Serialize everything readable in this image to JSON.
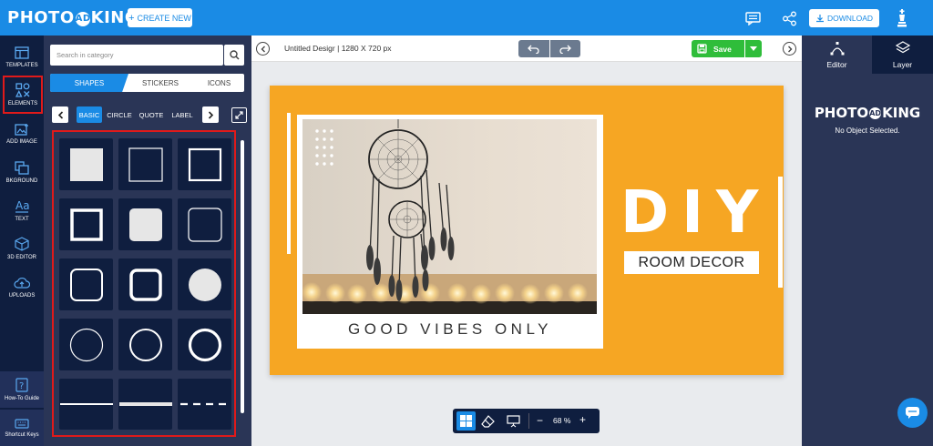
{
  "app": {
    "logo_left": "PHOTO",
    "logo_badge": "AD",
    "logo_right": "KING",
    "create_label": "CREATE NEW",
    "download_label": "DOWNLOAD"
  },
  "nav": {
    "items": [
      {
        "label": "TEMPLATES",
        "icon": "templates-icon"
      },
      {
        "label": "ELEMENTS",
        "icon": "elements-icon"
      },
      {
        "label": "ADD IMAGE",
        "icon": "add-image-icon"
      },
      {
        "label": "BKGROUND",
        "icon": "background-icon"
      },
      {
        "label": "TEXT",
        "icon": "text-icon"
      },
      {
        "label": "3D EDITOR",
        "icon": "3d-editor-icon"
      },
      {
        "label": "UPLOADS",
        "icon": "upload-icon"
      }
    ],
    "howto_label": "How-To Guide",
    "shortcut_label": "Shortcut Keys"
  },
  "panel": {
    "search_placeholder": "Search in category",
    "tabs": [
      "SHAPES",
      "STICKERS",
      "ICONS"
    ],
    "subtabs": [
      "BASIC",
      "CIRCLE",
      "QUOTE",
      "LABEL"
    ]
  },
  "editor": {
    "doc_name": "Untitled Desigr",
    "doc_size": "1280 X 720 px",
    "save_label": "Save",
    "zoom": "68 %"
  },
  "design": {
    "tagline": "GOOD VIBES ONLY",
    "headline": "DIY",
    "subhead": "ROOM DECOR"
  },
  "right": {
    "tab_editor": "Editor",
    "tab_layer": "Layer",
    "status": "No Object Selected."
  },
  "colors": {
    "brand": "#1a8be5",
    "dark": "#0f1e3f",
    "panel": "#2a3556",
    "artboard": "#f6a623",
    "save": "#2fbd3a",
    "highlight": "#e01a1a"
  }
}
